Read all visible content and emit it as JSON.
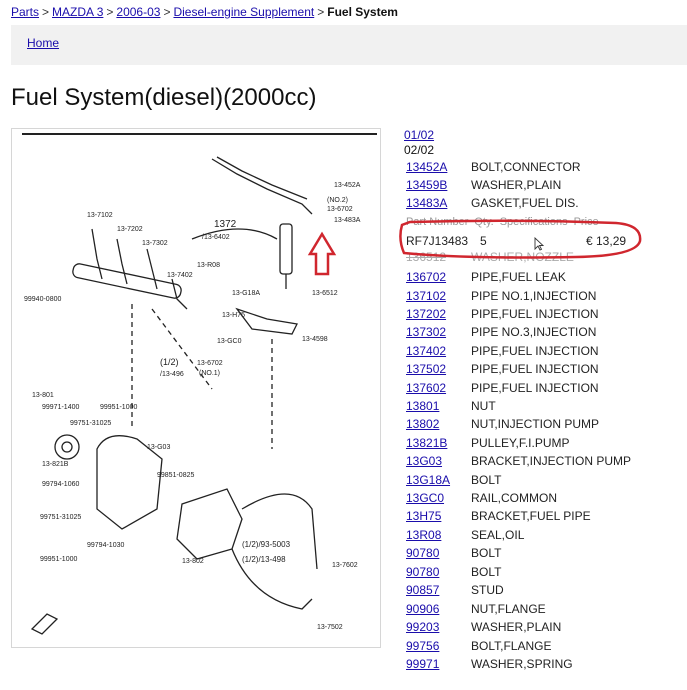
{
  "breadcrumb": {
    "parts": "Parts",
    "model": "MAZDA 3",
    "years": "2006-03",
    "group": "Diesel-engine Supplement",
    "current": "Fuel System"
  },
  "nav": {
    "home": "Home"
  },
  "title": "Fuel System(diesel)(2000cc)",
  "pagination": {
    "page1": "01/02",
    "page2": "02/02"
  },
  "popup": {
    "header": [
      "Part Number",
      "Qty.",
      "Specifications",
      "Price"
    ],
    "part_number": "RF7J13483",
    "qty": "5",
    "price": "€ 13,29"
  },
  "parts": [
    {
      "code": "13452A",
      "desc": "BOLT,CONNECTOR"
    },
    {
      "code": "13459B",
      "desc": "WASHER,PLAIN"
    },
    {
      "code": "13483A",
      "desc": "GASKET,FUEL DIS."
    },
    {
      "code": "136512",
      "desc": "WASHER,NOZZLE"
    },
    {
      "code": "136702",
      "desc": "PIPE,FUEL LEAK"
    },
    {
      "code": "137102",
      "desc": "PIPE NO.1,INJECTION"
    },
    {
      "code": "137202",
      "desc": "PIPE,FUEL INJECTION"
    },
    {
      "code": "137302",
      "desc": "PIPE NO.3,INJECTION"
    },
    {
      "code": "137402",
      "desc": "PIPE,FUEL INJECTION"
    },
    {
      "code": "137502",
      "desc": "PIPE,FUEL INJECTION"
    },
    {
      "code": "137602",
      "desc": "PIPE,FUEL INJECTION"
    },
    {
      "code": "13801",
      "desc": "NUT"
    },
    {
      "code": "13802",
      "desc": "NUT,INJECTION PUMP"
    },
    {
      "code": "13821B",
      "desc": "PULLEY,F.I.PUMP"
    },
    {
      "code": "13G03",
      "desc": "BRACKET,INJECTION PUMP"
    },
    {
      "code": "13G18A",
      "desc": "BOLT"
    },
    {
      "code": "13GC0",
      "desc": "RAIL,COMMON"
    },
    {
      "code": "13H75",
      "desc": "BRACKET,FUEL PIPE"
    },
    {
      "code": "13R08",
      "desc": "SEAL,OIL"
    },
    {
      "code": "90780",
      "desc": "BOLT"
    },
    {
      "code": "90780",
      "desc": "BOLT"
    },
    {
      "code": "90857",
      "desc": "STUD"
    },
    {
      "code": "90906",
      "desc": "NUT,FLANGE"
    },
    {
      "code": "99203",
      "desc": "WASHER,PLAIN"
    },
    {
      "code": "99756",
      "desc": "BOLT,FLANGE"
    },
    {
      "code": "99971",
      "desc": "WASHER,SPRING"
    }
  ],
  "diagram_labels": {
    "l1": "13-452A",
    "l2": "(NO.2)",
    "l3": "13-6702",
    "l4": "13-483A",
    "l5": "13-7102",
    "l6": "13-7202",
    "l7": "1372",
    "l8": "/13-6402",
    "l9": "13-7302",
    "l10": "13-R08",
    "l11": "13-7402",
    "l12": "99940-0800",
    "l13": "13-G18A",
    "l14": "13-6512",
    "l15": "13-H75",
    "l16": "13-GC0",
    "l17": "13-4598",
    "l18": "(1/2)",
    "l19": "13-6702",
    "l20": "/13-496",
    "l21": "(NO.1)",
    "l22": "13-801",
    "l23": "99971-1400",
    "l24": "99951-1000",
    "l25": "99751-31025",
    "l26": "13-G03",
    "l27": "13-821B",
    "l28": "99851-0825",
    "l29": "99794-1060",
    "l30": "99751-31025",
    "l31": "99794-1030",
    "l32": "99951-1000",
    "l33": "(1/2)/93-5003",
    "l34": "(1/2)/13-498",
    "l35": "13-802",
    "l36": "13-7602",
    "l37": "13-7502"
  },
  "colors": {
    "link": "#1a0dab",
    "highlight": "#d0262e"
  }
}
